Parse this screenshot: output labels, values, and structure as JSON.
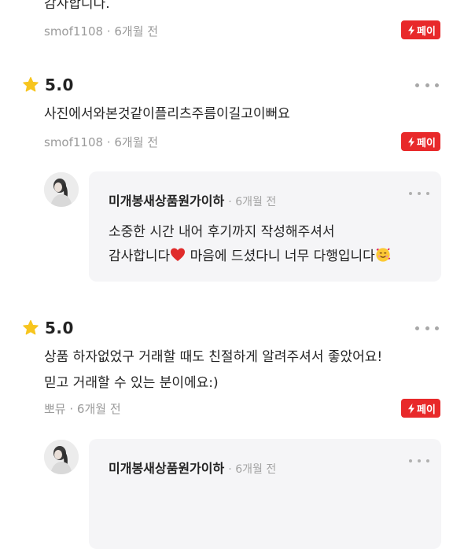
{
  "colors": {
    "star": "#f7c51e",
    "pay_badge": "#e8292a",
    "meta_text": "#9a9a9a",
    "reply_background": "#f5f5f7"
  },
  "reviews": [
    {
      "text_lines": [
        "감사합니다."
      ],
      "author": "smof1108",
      "time": "· 6개월 전",
      "pay_label": "페이"
    },
    {
      "rating": "5.0",
      "text_lines": [
        "사진에서와본것같이플리츠주름이길고이뻐요"
      ],
      "author": "smof1108",
      "time": "· 6개월 전",
      "pay_label": "페이",
      "reply": {
        "name": "미개봉새상품원가이하",
        "time": "· 6개월 전",
        "line1": "소중한 시간 내어 후기까지 작성해주셔서",
        "line2_before": "감사합니다",
        "line2_emoji1": "red-heart-emoji",
        "line2_middle": " 마음에 드셨다니 너무 다행입니다",
        "line2_emoji2": "smiling-face-with-hearts-emoji"
      }
    },
    {
      "rating": "5.0",
      "text_lines": [
        "상품 하자없었구 거래할 때도 친절하게 알려주셔서 좋았어요!",
        "믿고 거래할 수 있는 분이에요:)"
      ],
      "author": "뽀뮤",
      "time": "· 6개월 전",
      "pay_label": "페이",
      "reply": {
        "name": "미개봉새상품원가이하",
        "time": "· 6개월 전"
      }
    }
  ],
  "icons": {
    "star": "star-icon",
    "more": "more-options-icon",
    "pay": "lightning-icon",
    "avatar": "seller-avatar"
  }
}
